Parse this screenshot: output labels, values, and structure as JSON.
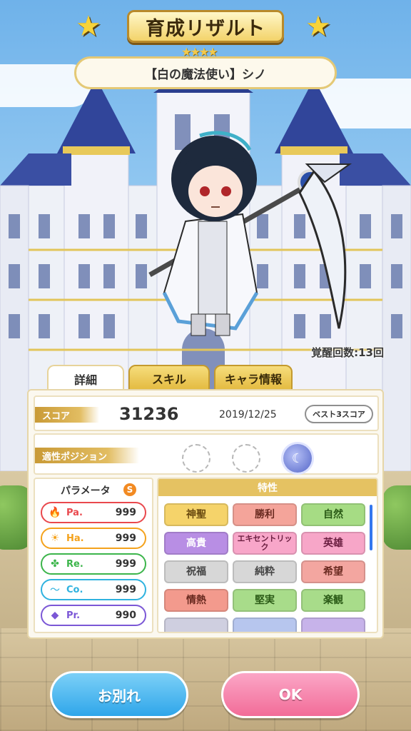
{
  "header": {
    "title": "育成リザルト",
    "rarity_stars": "★★★★",
    "character_name": "【白の魔法使い】シノ"
  },
  "awaken_count": "覚醒回数:13回",
  "tabs": [
    {
      "label": "詳細",
      "active": true
    },
    {
      "label": "スキル",
      "active": false
    },
    {
      "label": "キャラ情報",
      "active": false
    }
  ],
  "score": {
    "label": "スコア",
    "value": "31236",
    "date": "2019/12/25",
    "best3_label": "ベスト3スコア"
  },
  "position": {
    "label": "適性ポジション"
  },
  "parameters": {
    "title": "パラメータ",
    "rank": "S",
    "items": [
      {
        "label": "Pa.",
        "value": "999",
        "color": "#e9484d",
        "icon": "flame-icon",
        "glyph": "🔥"
      },
      {
        "label": "Ha.",
        "value": "999",
        "color": "#f4a21c",
        "icon": "sun-icon",
        "glyph": "☀"
      },
      {
        "label": "Re.",
        "value": "999",
        "color": "#3cb54b",
        "icon": "clover-icon",
        "glyph": "✤"
      },
      {
        "label": "Co.",
        "value": "999",
        "color": "#2fb2df",
        "icon": "wind-icon",
        "glyph": "〜"
      },
      {
        "label": "Pr.",
        "value": "990",
        "color": "#7b57d6",
        "icon": "gem-icon",
        "glyph": "◆"
      }
    ]
  },
  "traits": {
    "title": "特性",
    "items": [
      {
        "label": "神聖",
        "color": "#f5d36a"
      },
      {
        "label": "勝利",
        "color": "#f4a49a"
      },
      {
        "label": "自然",
        "color": "#a6dc84"
      },
      {
        "label": "高貴",
        "color": "#b88ee4"
      },
      {
        "label": "エキセントリック",
        "color": "#f8a6c9"
      },
      {
        "label": "英雄",
        "color": "#f7a6c8"
      },
      {
        "label": "祝福",
        "color": "#d7d7d7"
      },
      {
        "label": "純粋",
        "color": "#d7d7d7"
      },
      {
        "label": "希望",
        "color": "#f3a6a0"
      },
      {
        "label": "情熱",
        "color": "#f39a8d"
      },
      {
        "label": "堅実",
        "color": "#a8dc8a"
      },
      {
        "label": "楽観",
        "color": "#a8dc8a"
      }
    ]
  },
  "buttons": {
    "farewell": "お別れ",
    "ok": "OK"
  }
}
